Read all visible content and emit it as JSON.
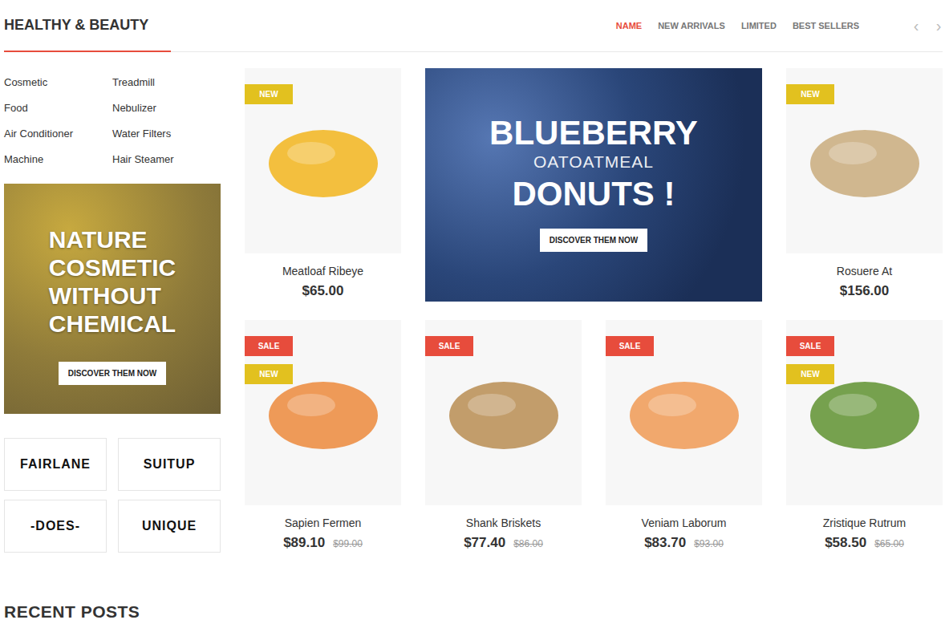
{
  "section": {
    "title": "HEALTHY & BEAUTY"
  },
  "tabs": [
    {
      "label": "NAME",
      "selected": true
    },
    {
      "label": "NEW ARRIVALS",
      "selected": false
    },
    {
      "label": "LIMITED",
      "selected": false
    },
    {
      "label": "BEST SELLERS",
      "selected": false
    }
  ],
  "nav": {
    "prev": "‹",
    "next": "›"
  },
  "categories": [
    "Cosmetic",
    "Treadmill",
    "Food",
    "Nebulizer",
    "Air Conditioner",
    "Water Filters",
    "Machine",
    "Hair Steamer"
  ],
  "side_banner": {
    "lines": [
      "NATURE",
      "COSMETIC",
      "WITHOUT",
      "CHEMICAL"
    ],
    "button": "DISCOVER THEM NOW"
  },
  "brands": [
    "FAIRLANE",
    "SUITUP",
    "-DOES-",
    "UNIQUE"
  ],
  "feature_banner": {
    "title": "BLUEBERRY",
    "subtitle": "OATOATMEAL",
    "headline": "DONUTS !",
    "button": "DISCOVER THEM NOW"
  },
  "products": [
    {
      "name": "Meatloaf Ribeye",
      "price": "$65.00",
      "old_price": "",
      "badges": [
        {
          "label": "NEW",
          "kind": "new"
        }
      ]
    },
    {
      "name": "Rosuere At",
      "price": "$156.00",
      "old_price": "",
      "badges": [
        {
          "label": "NEW",
          "kind": "new"
        }
      ]
    },
    {
      "name": "Sapien Fermen",
      "price": "$89.10",
      "old_price": "$99.00",
      "badges": [
        {
          "label": "SALE",
          "kind": "sale"
        },
        {
          "label": "NEW",
          "kind": "new"
        }
      ]
    },
    {
      "name": "Shank Briskets",
      "price": "$77.40",
      "old_price": "$86.00",
      "badges": [
        {
          "label": "SALE",
          "kind": "sale"
        }
      ]
    },
    {
      "name": "Veniam Laborum",
      "price": "$83.70",
      "old_price": "$93.00",
      "badges": [
        {
          "label": "SALE",
          "kind": "sale"
        }
      ]
    },
    {
      "name": "Zristique Rutrum",
      "price": "$58.50",
      "old_price": "$65.00",
      "badges": [
        {
          "label": "SALE",
          "kind": "sale"
        },
        {
          "label": "NEW",
          "kind": "new"
        }
      ]
    }
  ],
  "recent_posts": {
    "title": "RECENT POSTS"
  }
}
